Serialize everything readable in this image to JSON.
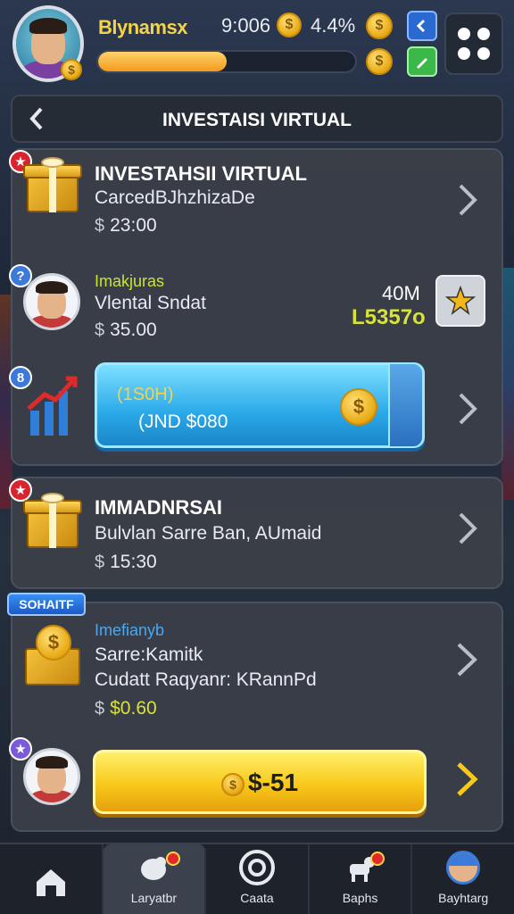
{
  "hud": {
    "player_name": "Blynamsx",
    "stat_a": "9:006",
    "stat_b": "4.4%",
    "xp_progress": 0.5
  },
  "header": {
    "title": "INVESTAISI VIRTUAL"
  },
  "card1": {
    "title": "INVESTAHSII VIRTUAL",
    "subtitle": "CarcedBJhzhizaDe",
    "price": "23:00"
  },
  "card1_row2": {
    "tag": "Imakjuras",
    "subtitle": "Vlental Sndat",
    "price": "35.00",
    "amount": "40M",
    "value": "L5357o"
  },
  "card1_row3": {
    "badge": "8",
    "collect_top": "(1S0H)",
    "collect_bottom": "(JND $080"
  },
  "card2": {
    "title": "IMMADNRSAI",
    "subtitle": "Bulvlan Sarre Ban, AUmaid",
    "price": "15:30"
  },
  "card3": {
    "sale_tag": "SOHAITF",
    "tag": "Imefianyb",
    "line1": "Sarre:Kamitk",
    "line2": "Cudatt Raqyanr: KRannPd",
    "price": "$0.60",
    "button_label": "$-51"
  },
  "bottom_nav": {
    "items": [
      {
        "label": "",
        "icon": "home-icon"
      },
      {
        "label": "Laryatbr",
        "icon": "bird-icon"
      },
      {
        "label": "Caata",
        "icon": "ring-icon"
      },
      {
        "label": "Baphs",
        "icon": "dog-icon"
      },
      {
        "label": "Bayhtarg",
        "icon": "avatar-icon"
      }
    ]
  },
  "colors": {
    "accent_gold": "#f8c81a",
    "accent_blue": "#2aa8e8",
    "badge_red": "#d8242f"
  }
}
